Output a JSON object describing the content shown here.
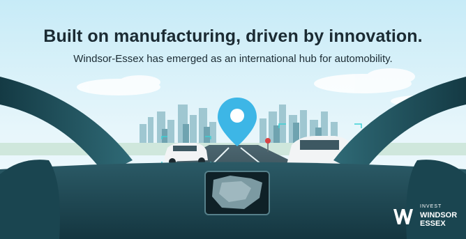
{
  "headline": "Built on manufacturing, driven by innovation.",
  "subheadline": "Windsor-Essex has emerged as an international hub for automobility.",
  "logo": {
    "small_text": "INVEST",
    "line1": "WINDSOR",
    "line2": "ESSEX"
  },
  "colors": {
    "sky_top": "#bfe7f5",
    "sky_bottom": "#e9f7fb",
    "dashboard": "#1f4a55",
    "headline_text": "#1b2b33",
    "pin": "#3db6e6",
    "car": "#f2f4f5"
  },
  "icons": [
    "location-pin-icon",
    "invest-windsor-essex-logo"
  ]
}
